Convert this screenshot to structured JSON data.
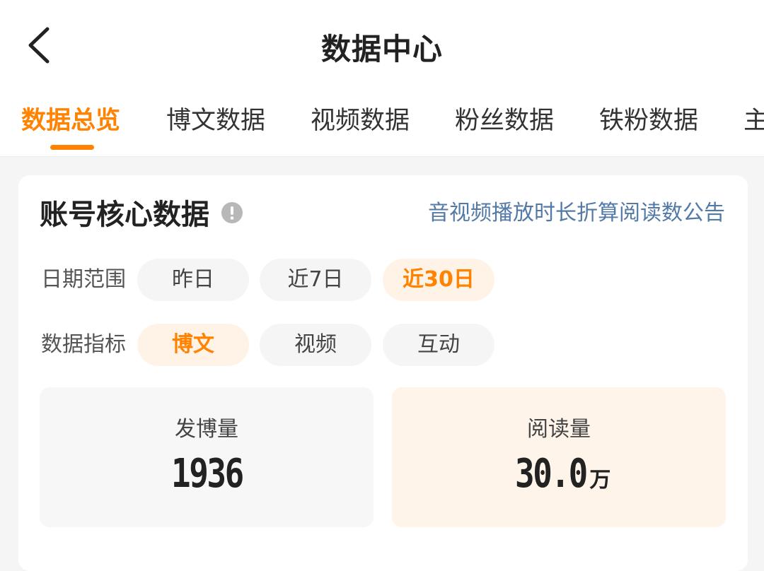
{
  "header": {
    "title": "数据中心",
    "back_icon": "chevron-left-icon"
  },
  "tabs": [
    {
      "label": "数据总览",
      "active": true
    },
    {
      "label": "博文数据",
      "active": false
    },
    {
      "label": "视频数据",
      "active": false
    },
    {
      "label": "粉丝数据",
      "active": false
    },
    {
      "label": "铁粉数据",
      "active": false
    },
    {
      "label": "主",
      "active": false
    }
  ],
  "core": {
    "title": "账号核心数据",
    "info_icon": "info-icon",
    "notice_link": "音视频播放时长折算阅读数公告",
    "date_range": {
      "label": "日期范围",
      "options": [
        "昨日",
        "近7日",
        "近30日"
      ],
      "selected": "近30日"
    },
    "metric": {
      "label": "数据指标",
      "options": [
        "博文",
        "视频",
        "互动"
      ],
      "selected": "博文"
    },
    "stats": [
      {
        "label": "发博量",
        "value": "1936",
        "unit": ""
      },
      {
        "label": "阅读量",
        "value": "30.0",
        "unit": "万"
      }
    ]
  },
  "colors": {
    "accent": "#ff8200",
    "accent_bg": "#fff3e7",
    "link": "#537aa7"
  }
}
